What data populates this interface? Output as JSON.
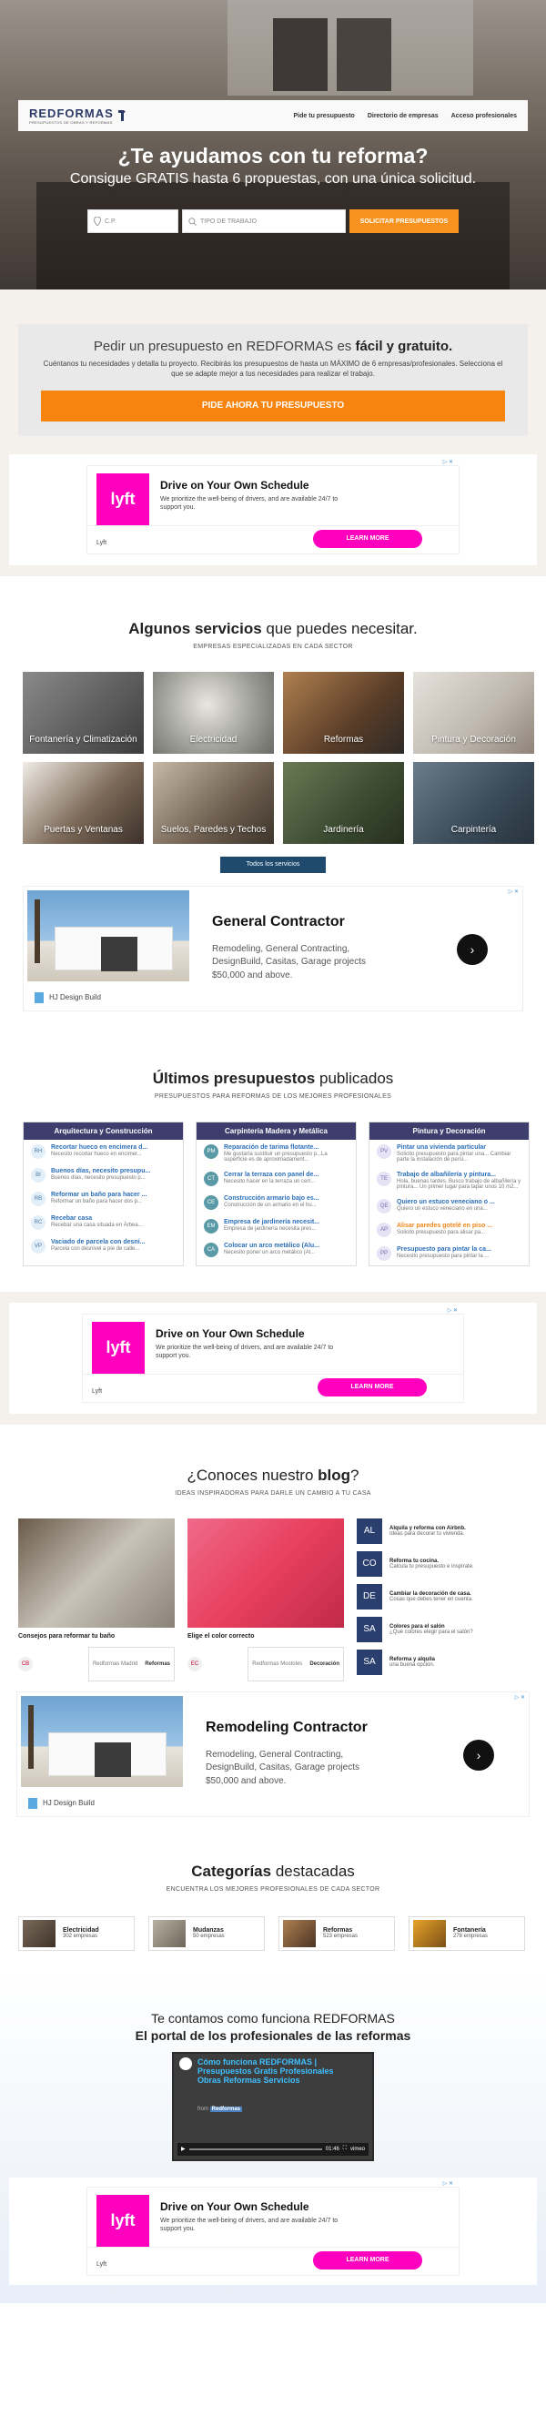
{
  "header": {
    "logo_text": "REDFORMAS",
    "logo_tag": "PRESUPUESTOS DE OBRAS Y REFORMAS",
    "nav": [
      "Pide tu presupuesto",
      "Directorio de empresas",
      "Acceso profesionales"
    ]
  },
  "hero": {
    "title": "¿Te ayudamos con tu reforma?",
    "subtitle": "Consigue GRATIS hasta 6 propuestas, con una única solicitud.",
    "cp_placeholder": "C.P.",
    "work_placeholder": "TIPO DE TRABAJO",
    "button": "SOLICITAR PRESUPUESTOS"
  },
  "quote": {
    "title_plain": "Pedir un presupuesto en REDFORMAS es",
    "title_bold": "fácil y gratuito.",
    "text": "Cuéntanos tu necesidades y detalla tu proyecto. Recibirás los presupuestos de hasta un MÁXIMO de 6 empresas/profesionales. Selecciona el que se adapte mejor a tus necesidades para realizar el trabajo.",
    "button": "PIDE AHORA TU PRESUPUESTO"
  },
  "lyft_ad": {
    "ad_tag": "▷ ✕",
    "logo": "lyft",
    "title": "Drive on Your Own Schedule",
    "desc": "We prioritize the well-being of drivers, and are available 24/7 to support you.",
    "brand": "Lyft",
    "button": "LEARN MORE"
  },
  "services": {
    "title_bold": "Algunos servicios",
    "title_plain": "que puedes necesitar.",
    "subtitle": "EMPRESAS ESPECIALIZADAS EN CADA SECTOR",
    "items": [
      "Fontanería y Climatización",
      "Electricidad",
      "Reformas",
      "Pintura y Decoración",
      "Puertas y Ventanas",
      "Suelos, Paredes y Techos",
      "Jardinería",
      "Carpintería"
    ],
    "all_button": "Todos los servicios"
  },
  "gc_ad": {
    "ad_tag": "▷ ✕",
    "title": "General Contractor",
    "desc": "Remodeling, General Contracting, DesignBuild, Casitas, Garage projects $50,000 and above.",
    "brand": "HJ Design Build",
    "arrow": "›"
  },
  "budgets": {
    "title_bold": "Últimos presupuestos",
    "title_plain": "publicados",
    "subtitle": "PRESUPUESTOS PARA REFORMAS DE LOS MEJORES PROFESIONALES",
    "columns": [
      {
        "header": "Arquitectura y Construcción",
        "items": [
          {
            "av": "RH",
            "title": "Recortar hueco en encimera d...",
            "desc": "Necesito recortar hueco en encimer..."
          },
          {
            "av": "BI",
            "title": "Buenos días, necesito presupu...",
            "desc": "Buenos días, necesito presupuesto p..."
          },
          {
            "av": "RB",
            "title": "Reformar un baño para hacer ...",
            "desc": "Reformar un baño para hacer dos p..."
          },
          {
            "av": "RC",
            "title": "Recebar casa",
            "desc": "Recebar una casa situada en Árbea..."
          },
          {
            "av": "VP",
            "title": "Vaciado de parcela con desni...",
            "desc": "Parcela con desnivel a pie de calle..."
          }
        ]
      },
      {
        "header": "Carpintería Madera y Metálica",
        "items": [
          {
            "av": "PM",
            "title": "Reparación de tarima flotante...",
            "desc": "Me gustaría sustituir un presupuesto p...La superficie es de aproximadament..."
          },
          {
            "av": "CT",
            "title": "Cerrar la terraza con panel de...",
            "desc": "Necesito hacer en la terraza un cerr..."
          },
          {
            "av": "CE",
            "title": "Construcción armario bajo es...",
            "desc": "Construcción de un armario en el hu..."
          },
          {
            "av": "EM",
            "title": "Empresa de jardinería necesit...",
            "desc": "Empresa de jardinería necesita pres..."
          },
          {
            "av": "CA",
            "title": "Colocar un arco metálico (Alu...",
            "desc": "Necesito poner un arco metálico (Al..."
          }
        ]
      },
      {
        "header": "Pintura y Decoración",
        "items": [
          {
            "av": "PV",
            "title": "Pintar una vivienda particular",
            "desc": "Solicito presupuesto para pintar una... Cambiar parte la instalación de persi..."
          },
          {
            "av": "TE",
            "title": "Trabajo de albañilería y pintura...",
            "desc": "Hola, buenas tardes. Busco trabajo de albañilería y pintura... Un primer lugar para tapar unos 10 m2..."
          },
          {
            "av": "QE",
            "title": "Quiero un estuco veneciano o ...",
            "desc": "Quiero un estuco veneciano en una..."
          },
          {
            "av": "AP",
            "title": "Alisar paredes gotelé en piso ...",
            "desc": "Solicito presupuesto para alisar pa..."
          },
          {
            "av": "PP",
            "title": "Presupuesto para pintar la ca...",
            "desc": "Necesito presupuesto para pintar la ..."
          }
        ]
      }
    ]
  },
  "blog": {
    "title_plain": "¿Conoces nuestro",
    "title_bold": "blog",
    "title_end": "?",
    "subtitle": "IDEAS INSPIRADORAS PARA DARLE UN CAMBIO A TU CASA",
    "posts": [
      {
        "title": "Consejos para reformar tu baño",
        "av": "CB",
        "author": "Redformas Madrid",
        "category": "Reformas"
      },
      {
        "title": "Elige el color correcto",
        "av": "EC",
        "author": "Redformas Mostoles",
        "category": "Decoración"
      }
    ],
    "list": [
      {
        "sq": "AL",
        "title": "Alquila y reforma con Airbnb.",
        "sub": "Ideas para decorar tu vivienda."
      },
      {
        "sq": "CO",
        "title": "Reforma tu cocina.",
        "sub": "Calcula tu presupuesto e inspírate."
      },
      {
        "sq": "DE",
        "title": "Cambiar la decoración de casa.",
        "sub": "Cosas que debes tener en cuenta."
      },
      {
        "sq": "SA",
        "title": "Colores para el salón",
        "sub": "¿Qué colores elegir para el salón?"
      },
      {
        "sq": "SA",
        "title": "Reforma y alquila",
        "sub": "una buena opción."
      }
    ]
  },
  "rc_ad": {
    "ad_tag": "▷ ✕",
    "title": "Remodeling Contractor",
    "desc": "Remodeling, General Contracting, DesignBuild, Casitas, Garage projects $50,000 and above.",
    "brand": "HJ Design Build",
    "arrow": "›"
  },
  "categories": {
    "title_bold": "Categorías",
    "title_plain": "destacadas",
    "subtitle": "ENCUENTRA LOS MEJORES PROFESIONALES DE CADA SECTOR",
    "items": [
      {
        "name": "Electricidad",
        "count": "302 empresas"
      },
      {
        "name": "Mudanzas",
        "count": "50 empresas"
      },
      {
        "name": "Reformas",
        "count": "523 empresas"
      },
      {
        "name": "Fontanería",
        "count": "278 empresas"
      }
    ]
  },
  "how": {
    "line1": "Te contamos como funciona REDFORMAS",
    "line2": "El portal de los profesionales de las reformas",
    "video_title": "Cómo funciona REDFORMAS | Presupuestos Gratis Profesionales Obras Reformas Servicios",
    "video_from": "from",
    "video_author": "Redformas",
    "time": "01:46",
    "vimeo": "vimeo"
  }
}
